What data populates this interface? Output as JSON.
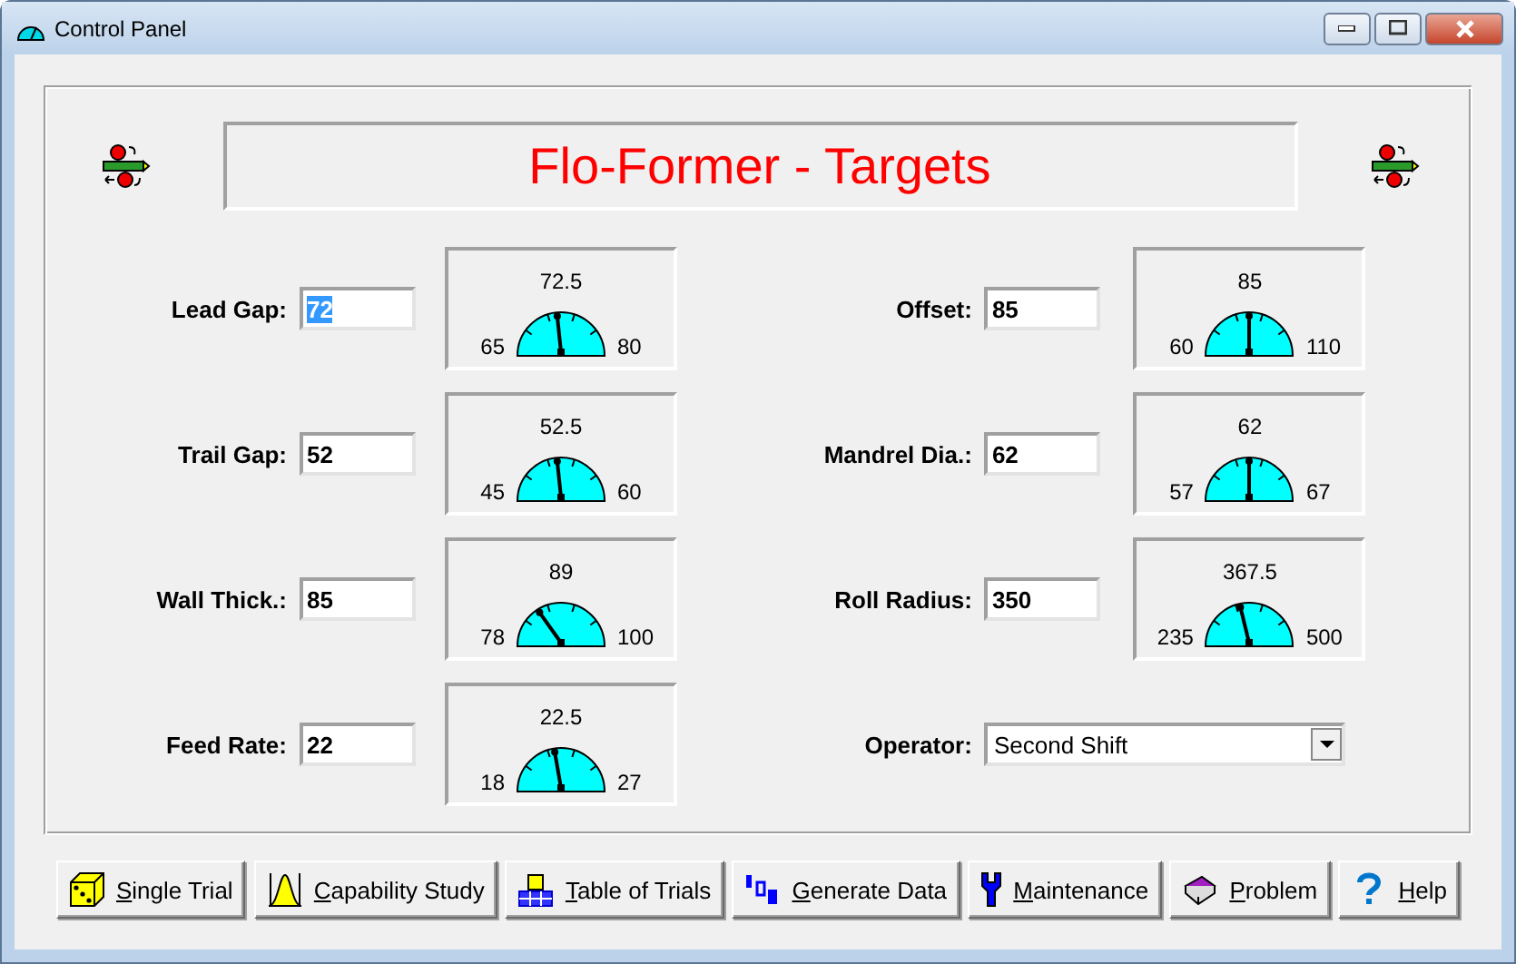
{
  "window": {
    "title": "Control Panel"
  },
  "header": {
    "title": "Flo-Former - Targets"
  },
  "left_params": [
    {
      "label": "Lead Gap:",
      "value": "72",
      "selected": true,
      "gauge": {
        "mid": "72.5",
        "min": "65",
        "max": "80",
        "level": 0.47
      }
    },
    {
      "label": "Trail Gap:",
      "value": "52",
      "selected": false,
      "gauge": {
        "mid": "52.5",
        "min": "45",
        "max": "60",
        "level": 0.47
      }
    },
    {
      "label": "Wall Thick.:",
      "value": "85",
      "selected": false,
      "gauge": {
        "mid": "89",
        "min": "78",
        "max": "100",
        "level": 0.32
      }
    },
    {
      "label": "Feed Rate:",
      "value": "22",
      "selected": false,
      "gauge": {
        "mid": "22.5",
        "min": "18",
        "max": "27",
        "level": 0.45
      }
    }
  ],
  "right_params": [
    {
      "label": "Offset:",
      "value": "85",
      "selected": false,
      "gauge": {
        "mid": "85",
        "min": "60",
        "max": "110",
        "level": 0.5
      }
    },
    {
      "label": "Mandrel Dia.:",
      "value": "62",
      "selected": false,
      "gauge": {
        "mid": "62",
        "min": "57",
        "max": "67",
        "level": 0.5
      }
    },
    {
      "label": "Roll Radius:",
      "value": "350",
      "selected": false,
      "gauge": {
        "mid": "367.5",
        "min": "235",
        "max": "500",
        "level": 0.43
      }
    }
  ],
  "operator": {
    "label": "Operator:",
    "value": "Second Shift"
  },
  "buttons": [
    {
      "label": "Single Trial"
    },
    {
      "label": "Capability Study"
    },
    {
      "label": "Table of Trials"
    },
    {
      "label": "Generate Data"
    },
    {
      "label": "Maintenance"
    },
    {
      "label": "Problem"
    },
    {
      "label": "Help"
    }
  ]
}
